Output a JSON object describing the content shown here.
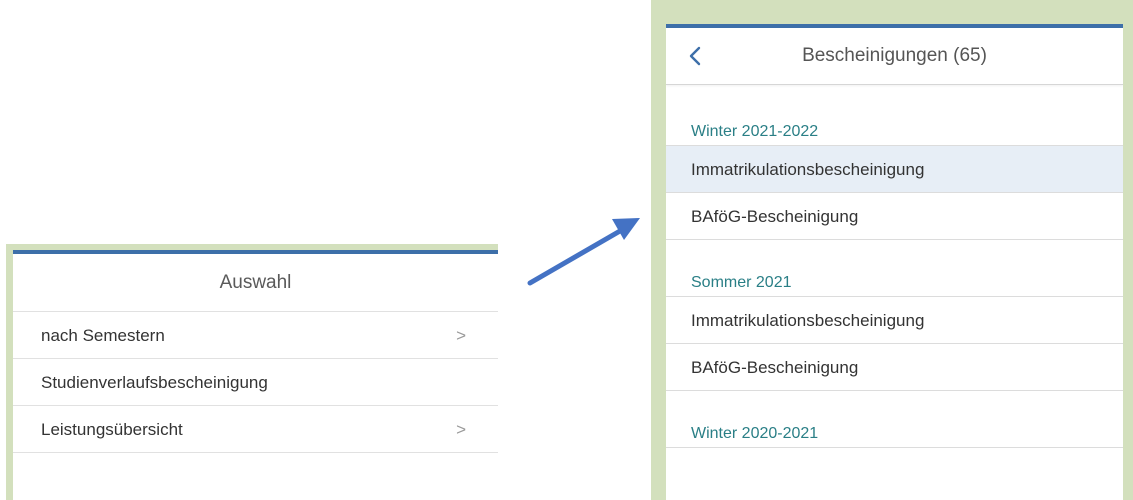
{
  "left": {
    "title": "Auswahl",
    "items": [
      {
        "label": "nach Semestern",
        "chevron": ">"
      },
      {
        "label": "Studienverlaufsbescheinigung",
        "chevron": ""
      },
      {
        "label": "Leistungsübersicht",
        "chevron": ">"
      }
    ]
  },
  "right": {
    "title": "Bescheinigungen (65)",
    "back_icon": "chevron-left-icon",
    "sections": [
      {
        "title": "Winter 2021-2022",
        "items": [
          {
            "label": "Immatrikulationsbescheinigung",
            "selected": true
          },
          {
            "label": "BAföG-Bescheinigung",
            "selected": false
          }
        ]
      },
      {
        "title": "Sommer 2021",
        "items": [
          {
            "label": "Immatrikulationsbescheinigung",
            "selected": false
          },
          {
            "label": "BAföG-Bescheinigung",
            "selected": false
          }
        ]
      },
      {
        "title": "Winter 2020-2021",
        "items": []
      }
    ]
  },
  "colors": {
    "frame_green": "#d3e0bd",
    "header_bar_blue": "#3d6fa9",
    "section_teal": "#2a7f86",
    "selected_row": "#e7eef6",
    "arrow_blue": "#4472c4"
  }
}
